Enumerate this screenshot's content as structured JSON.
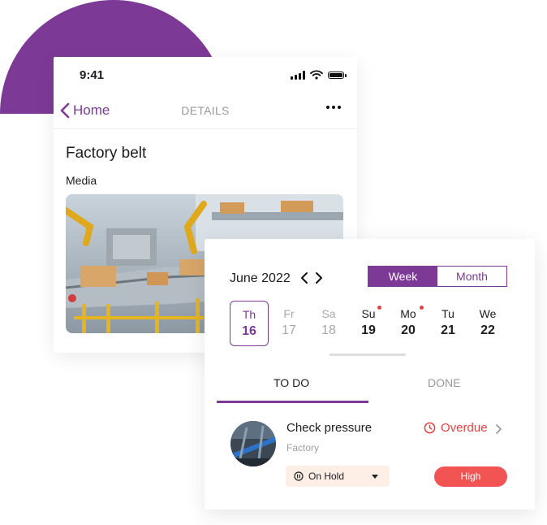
{
  "status_bar": {
    "time": "9:41"
  },
  "nav": {
    "back_label": "Home",
    "title": "DETAILS"
  },
  "detail": {
    "title": "Factory belt",
    "media_label": "Media"
  },
  "calendar": {
    "month": "June 2022",
    "view_options": [
      "Week",
      "Month"
    ],
    "selected_view": "Week",
    "days": [
      {
        "name": "Th",
        "date": "16",
        "state": "selected",
        "has_dot": false
      },
      {
        "name": "Fr",
        "date": "17",
        "state": "past",
        "has_dot": false
      },
      {
        "name": "Sa",
        "date": "18",
        "state": "past",
        "has_dot": false
      },
      {
        "name": "Su",
        "date": "19",
        "state": "upcoming",
        "has_dot": true
      },
      {
        "name": "Mo",
        "date": "20",
        "state": "upcoming",
        "has_dot": true
      },
      {
        "name": "Tu",
        "date": "21",
        "state": "upcoming",
        "has_dot": false
      },
      {
        "name": "We",
        "date": "22",
        "state": "upcoming",
        "has_dot": false
      }
    ]
  },
  "tabs": {
    "todo": "TO DO",
    "done": "DONE",
    "active": "TO DO"
  },
  "task": {
    "title": "Check pressure",
    "location": "Factory",
    "status": "Overdue",
    "state": "On Hold",
    "priority": "High"
  },
  "colors": {
    "accent": "#7c3a96",
    "danger": "#e84040",
    "priority_bg": "#f25454",
    "hold_bg": "#fdeee6"
  },
  "icons": [
    "chevron-left-icon",
    "more-icon",
    "chevron-left-icon",
    "chevron-right-icon",
    "clock-icon",
    "pause-icon",
    "caret-down-icon"
  ]
}
